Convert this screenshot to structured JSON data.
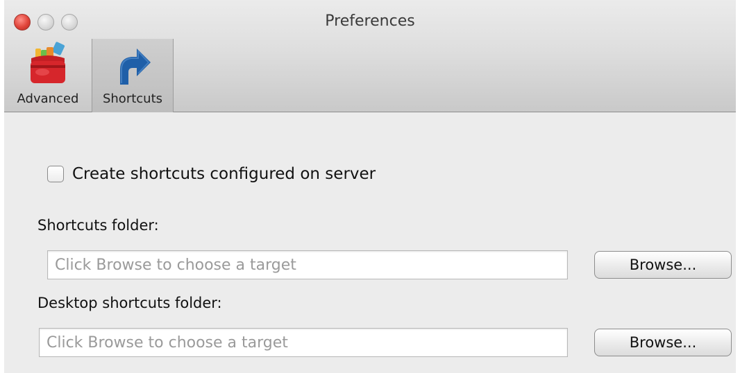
{
  "window": {
    "title": "Preferences"
  },
  "toolbar": {
    "items": [
      {
        "label": "Advanced",
        "icon": "toolbox-icon",
        "selected": false
      },
      {
        "label": "Shortcuts",
        "icon": "shortcut-arrow-icon",
        "selected": true
      }
    ]
  },
  "shortcuts": {
    "create_checkbox": {
      "label": "Create shortcuts configured on server",
      "checked": false
    },
    "shortcuts_folder": {
      "label": "Shortcuts folder:",
      "placeholder": "Click Browse to choose a target",
      "value": "",
      "browse_label": "Browse..."
    },
    "desktop_folder": {
      "label": "Desktop shortcuts folder:",
      "placeholder": "Click Browse to choose a target",
      "value": "",
      "browse_label": "Browse..."
    }
  },
  "colors": {
    "close_button": "#e0443a",
    "toolbar_selected": "#c4c4c4",
    "shortcut_arrow": "#1f5fa8",
    "toolbox_red": "#d6262b"
  }
}
